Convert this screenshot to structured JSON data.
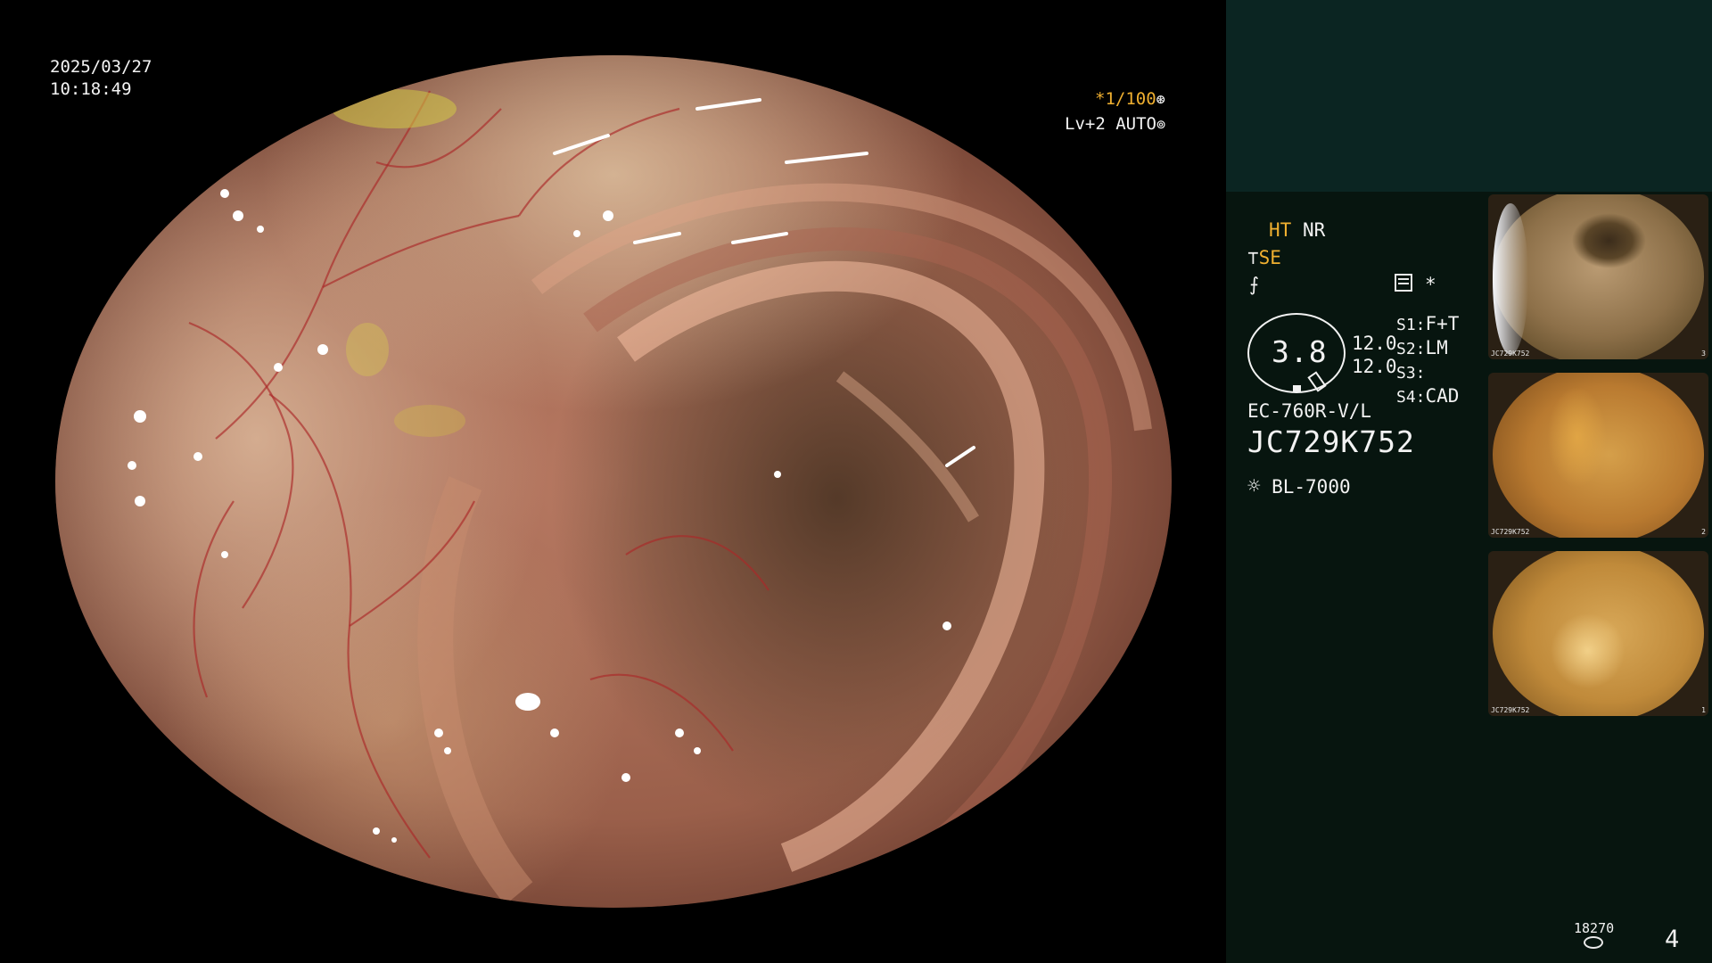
{
  "overlay": {
    "date": "2025/03/27",
    "time": "10:18:49",
    "shutter": "*1/100",
    "level": "Lv+2",
    "iris": "AUTO"
  },
  "panel": {
    "ht": "HT",
    "nr": "NR",
    "se": "SE",
    "asterisk": "*",
    "gauge_value": "3.8",
    "val1": "12.0",
    "val2": "12.0",
    "s1_label": "S1:",
    "s1_value": "F+T",
    "s2_label": "S2:",
    "s2_value": "LM",
    "s3_label": "S3:",
    "s3_value": "",
    "s4_label": "S4:",
    "s4_value": "CAD",
    "scope_model": "EC-760R-V/L",
    "scope_serial": "JC729K752",
    "light_source": "BL-7000",
    "storage_count": "18270",
    "image_count": "4"
  },
  "thumbnails": [
    {
      "serial": "JC729K752",
      "index": "3"
    },
    {
      "serial": "JC729K752",
      "index": "2"
    },
    {
      "serial": "JC729K752",
      "index": "1"
    }
  ],
  "colors": {
    "accent_yellow": "#f0b030",
    "panel_bg": "#07150f",
    "panel_top_bg": "#0b2522"
  }
}
